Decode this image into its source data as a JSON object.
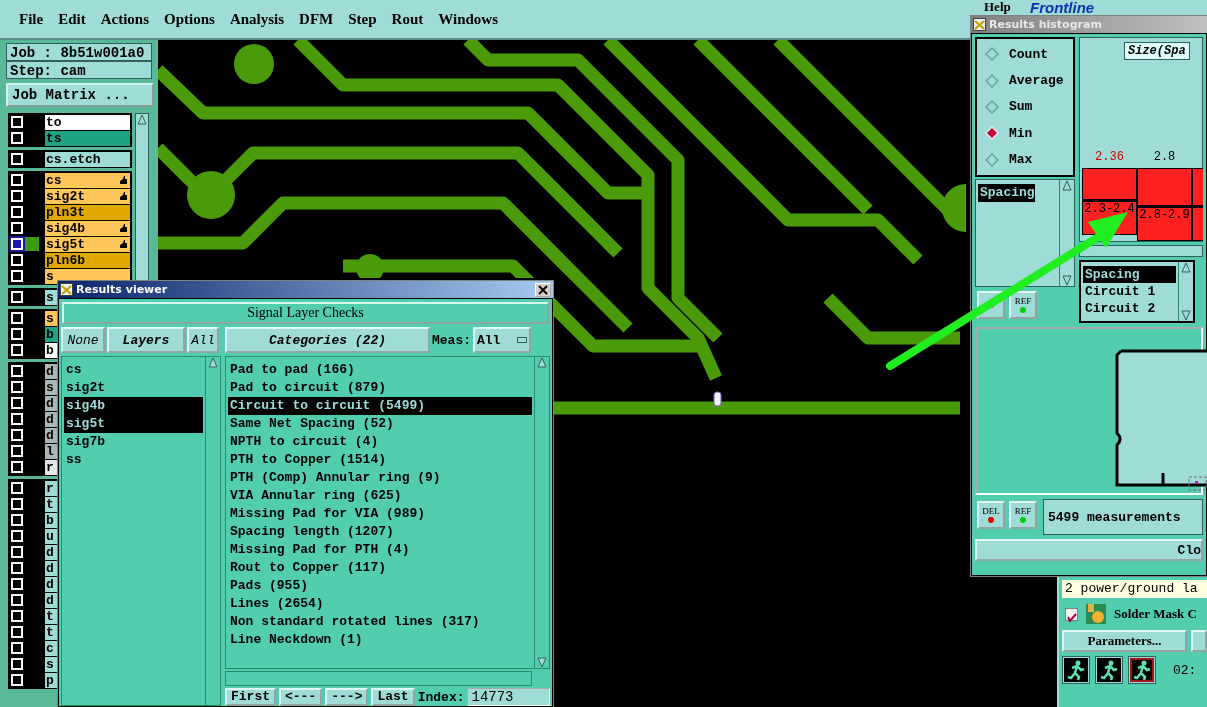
{
  "menu": [
    {
      "label": "File"
    },
    {
      "label": "Edit"
    },
    {
      "label": "Actions"
    },
    {
      "label": "Options"
    },
    {
      "label": "Analysis"
    },
    {
      "label": "DFM"
    },
    {
      "label": "Step"
    },
    {
      "label": "Rout"
    },
    {
      "label": "Windows"
    }
  ],
  "help": "Help",
  "logo": "Frontline",
  "job": "Job : 8b51w001a0",
  "step": "Step: cam",
  "job_matrix": "Job Matrix ...",
  "layer_groups": [
    {
      "layers": [
        {
          "name": "to",
          "color": "#ffffff",
          "selected": false,
          "hand": false
        },
        {
          "name": "ts",
          "color": "#1fa382",
          "selected": false,
          "hand": false
        }
      ]
    },
    {
      "layers": [
        {
          "name": "cs.etch",
          "color": "#9fdcd8",
          "selected": false,
          "hand": false
        }
      ]
    },
    {
      "layers": [
        {
          "name": "cs",
          "color": "#ffc65a",
          "selected": false,
          "hand": true
        },
        {
          "name": "sig2t",
          "color": "#ffc65a",
          "selected": false,
          "hand": true
        },
        {
          "name": "pln3t",
          "color": "#e0a800",
          "selected": false,
          "hand": false
        },
        {
          "name": "sig4b",
          "color": "#ffc65a",
          "selected": false,
          "hand": true
        },
        {
          "name": "sig5t",
          "color": "#ffc65a",
          "selected": true,
          "hand": true
        },
        {
          "name": "pln6b",
          "color": "#e0a800",
          "selected": false,
          "hand": false
        },
        {
          "name": "s",
          "color": "#ffc65a",
          "selected": false,
          "hand": false
        }
      ]
    },
    {
      "layers": [
        {
          "name": "s",
          "color": "#9fdcd8",
          "selected": false,
          "hand": false
        }
      ]
    },
    {
      "layers": [
        {
          "name": "s",
          "color": "#ffc65a",
          "selected": false,
          "hand": false
        },
        {
          "name": "b",
          "color": "#1fa382",
          "selected": false,
          "hand": false
        },
        {
          "name": "b",
          "color": "#ffffff",
          "selected": false,
          "hand": false
        }
      ]
    },
    {
      "layers": [
        {
          "name": "d",
          "color": "#a8b8b8",
          "selected": false,
          "hand": false
        },
        {
          "name": "s",
          "color": "#a8b8b8",
          "selected": false,
          "hand": false
        },
        {
          "name": "d",
          "color": "#a8b8b8",
          "selected": false,
          "hand": false
        },
        {
          "name": "d",
          "color": "#a8b8b8",
          "selected": false,
          "hand": false
        },
        {
          "name": "d",
          "color": "#a8b8b8",
          "selected": false,
          "hand": false
        },
        {
          "name": "l",
          "color": "#a8b8b8",
          "selected": false,
          "hand": false
        },
        {
          "name": "r",
          "color": "#e4e8e8",
          "selected": false,
          "hand": false
        }
      ]
    },
    {
      "layers": [
        {
          "name": "r",
          "color": "#9fdcd8",
          "selected": false,
          "hand": false
        },
        {
          "name": "t",
          "color": "#9fdcd8",
          "selected": false,
          "hand": false
        },
        {
          "name": "b",
          "color": "#9fdcd8",
          "selected": false,
          "hand": false
        },
        {
          "name": "u",
          "color": "#9fdcd8",
          "selected": false,
          "hand": false
        },
        {
          "name": "d",
          "color": "#9fdcd8",
          "selected": false,
          "hand": false
        },
        {
          "name": "d",
          "color": "#9fdcd8",
          "selected": false,
          "hand": false
        },
        {
          "name": "d",
          "color": "#9fdcd8",
          "selected": false,
          "hand": false
        },
        {
          "name": "d",
          "color": "#9fdcd8",
          "selected": false,
          "hand": false
        },
        {
          "name": "t",
          "color": "#9fdcd8",
          "selected": false,
          "hand": false
        },
        {
          "name": "t",
          "color": "#9fdcd8",
          "selected": false,
          "hand": false
        },
        {
          "name": "c",
          "color": "#9fdcd8",
          "selected": false,
          "hand": false
        },
        {
          "name": "s",
          "color": "#9fdcd8",
          "selected": false,
          "hand": false
        },
        {
          "name": "p",
          "color": "#9fdcd8",
          "selected": false,
          "hand": false
        }
      ]
    }
  ],
  "results_viewer": {
    "title": "Results viewer",
    "header": "Signal Layer Checks",
    "none": "None",
    "layers_label": "Layers",
    "all": "All",
    "layers": [
      {
        "name": "cs",
        "selected": false
      },
      {
        "name": "sig2t",
        "selected": false
      },
      {
        "name": "sig4b",
        "selected": true
      },
      {
        "name": "sig5t",
        "selected": true
      },
      {
        "name": "sig7b",
        "selected": false
      },
      {
        "name": "ss",
        "selected": false
      }
    ],
    "categories_label": "Categories (22)",
    "meas_label": "Meas:",
    "meas_value": "All",
    "categories": [
      {
        "label": "Pad to pad (166)",
        "selected": false
      },
      {
        "label": "Pad to circuit (879)",
        "selected": false
      },
      {
        "label": "Circuit to circuit (5499)",
        "selected": true
      },
      {
        "label": "Same Net Spacing (52)",
        "selected": false
      },
      {
        "label": "NPTH to circuit (4)",
        "selected": false
      },
      {
        "label": "PTH to Copper (1514)",
        "selected": false
      },
      {
        "label": "PTH (Comp) Annular ring (9)",
        "selected": false
      },
      {
        "label": "VIA Annular ring (625)",
        "selected": false
      },
      {
        "label": "Missing Pad for VIA (989)",
        "selected": false
      },
      {
        "label": "Spacing length (1207)",
        "selected": false
      },
      {
        "label": "Missing Pad for PTH (4)",
        "selected": false
      },
      {
        "label": "Rout to Copper (117)",
        "selected": false
      },
      {
        "label": "Pads (955)",
        "selected": false
      },
      {
        "label": "Lines (2654)",
        "selected": false
      },
      {
        "label": "Non standard rotated lines (317)",
        "selected": false
      },
      {
        "label": "Line Neckdown (1)",
        "selected": false
      }
    ],
    "nav": [
      "First",
      "<---",
      "--->",
      "Last"
    ],
    "index_label": "Index:",
    "index_value": "14773"
  },
  "histogram": {
    "title": "Results histogram",
    "modes": [
      {
        "label": "Count",
        "selected": false
      },
      {
        "label": "Average",
        "selected": false
      },
      {
        "label": "Sum",
        "selected": false
      },
      {
        "label": "Min",
        "selected": true
      },
      {
        "label": "Max",
        "selected": false
      }
    ],
    "measures": [
      {
        "label": "Spacing",
        "selected": true
      }
    ],
    "axis_label": "Size(Spa",
    "bins": [
      {
        "value": "2.36",
        "range": "2.3-2.4",
        "highlight": true
      },
      {
        "value": "2.8",
        "range": "2.8-2.9",
        "highlight": false
      }
    ],
    "features": [
      {
        "label": "Spacing",
        "selected": true
      },
      {
        "label": "Circuit 1",
        "selected": false
      },
      {
        "label": "Circuit 2",
        "selected": false
      }
    ],
    "upper_buttons": [
      "REF"
    ],
    "lower_buttons": [
      "DEL",
      "REF"
    ],
    "count": "5499 measurements",
    "close": "Clo"
  },
  "checklist": {
    "summary": "2 power/ground la",
    "item": {
      "label": "Solder Mask C",
      "checked": true
    },
    "parameters": "Parameters...",
    "time": "02:"
  }
}
